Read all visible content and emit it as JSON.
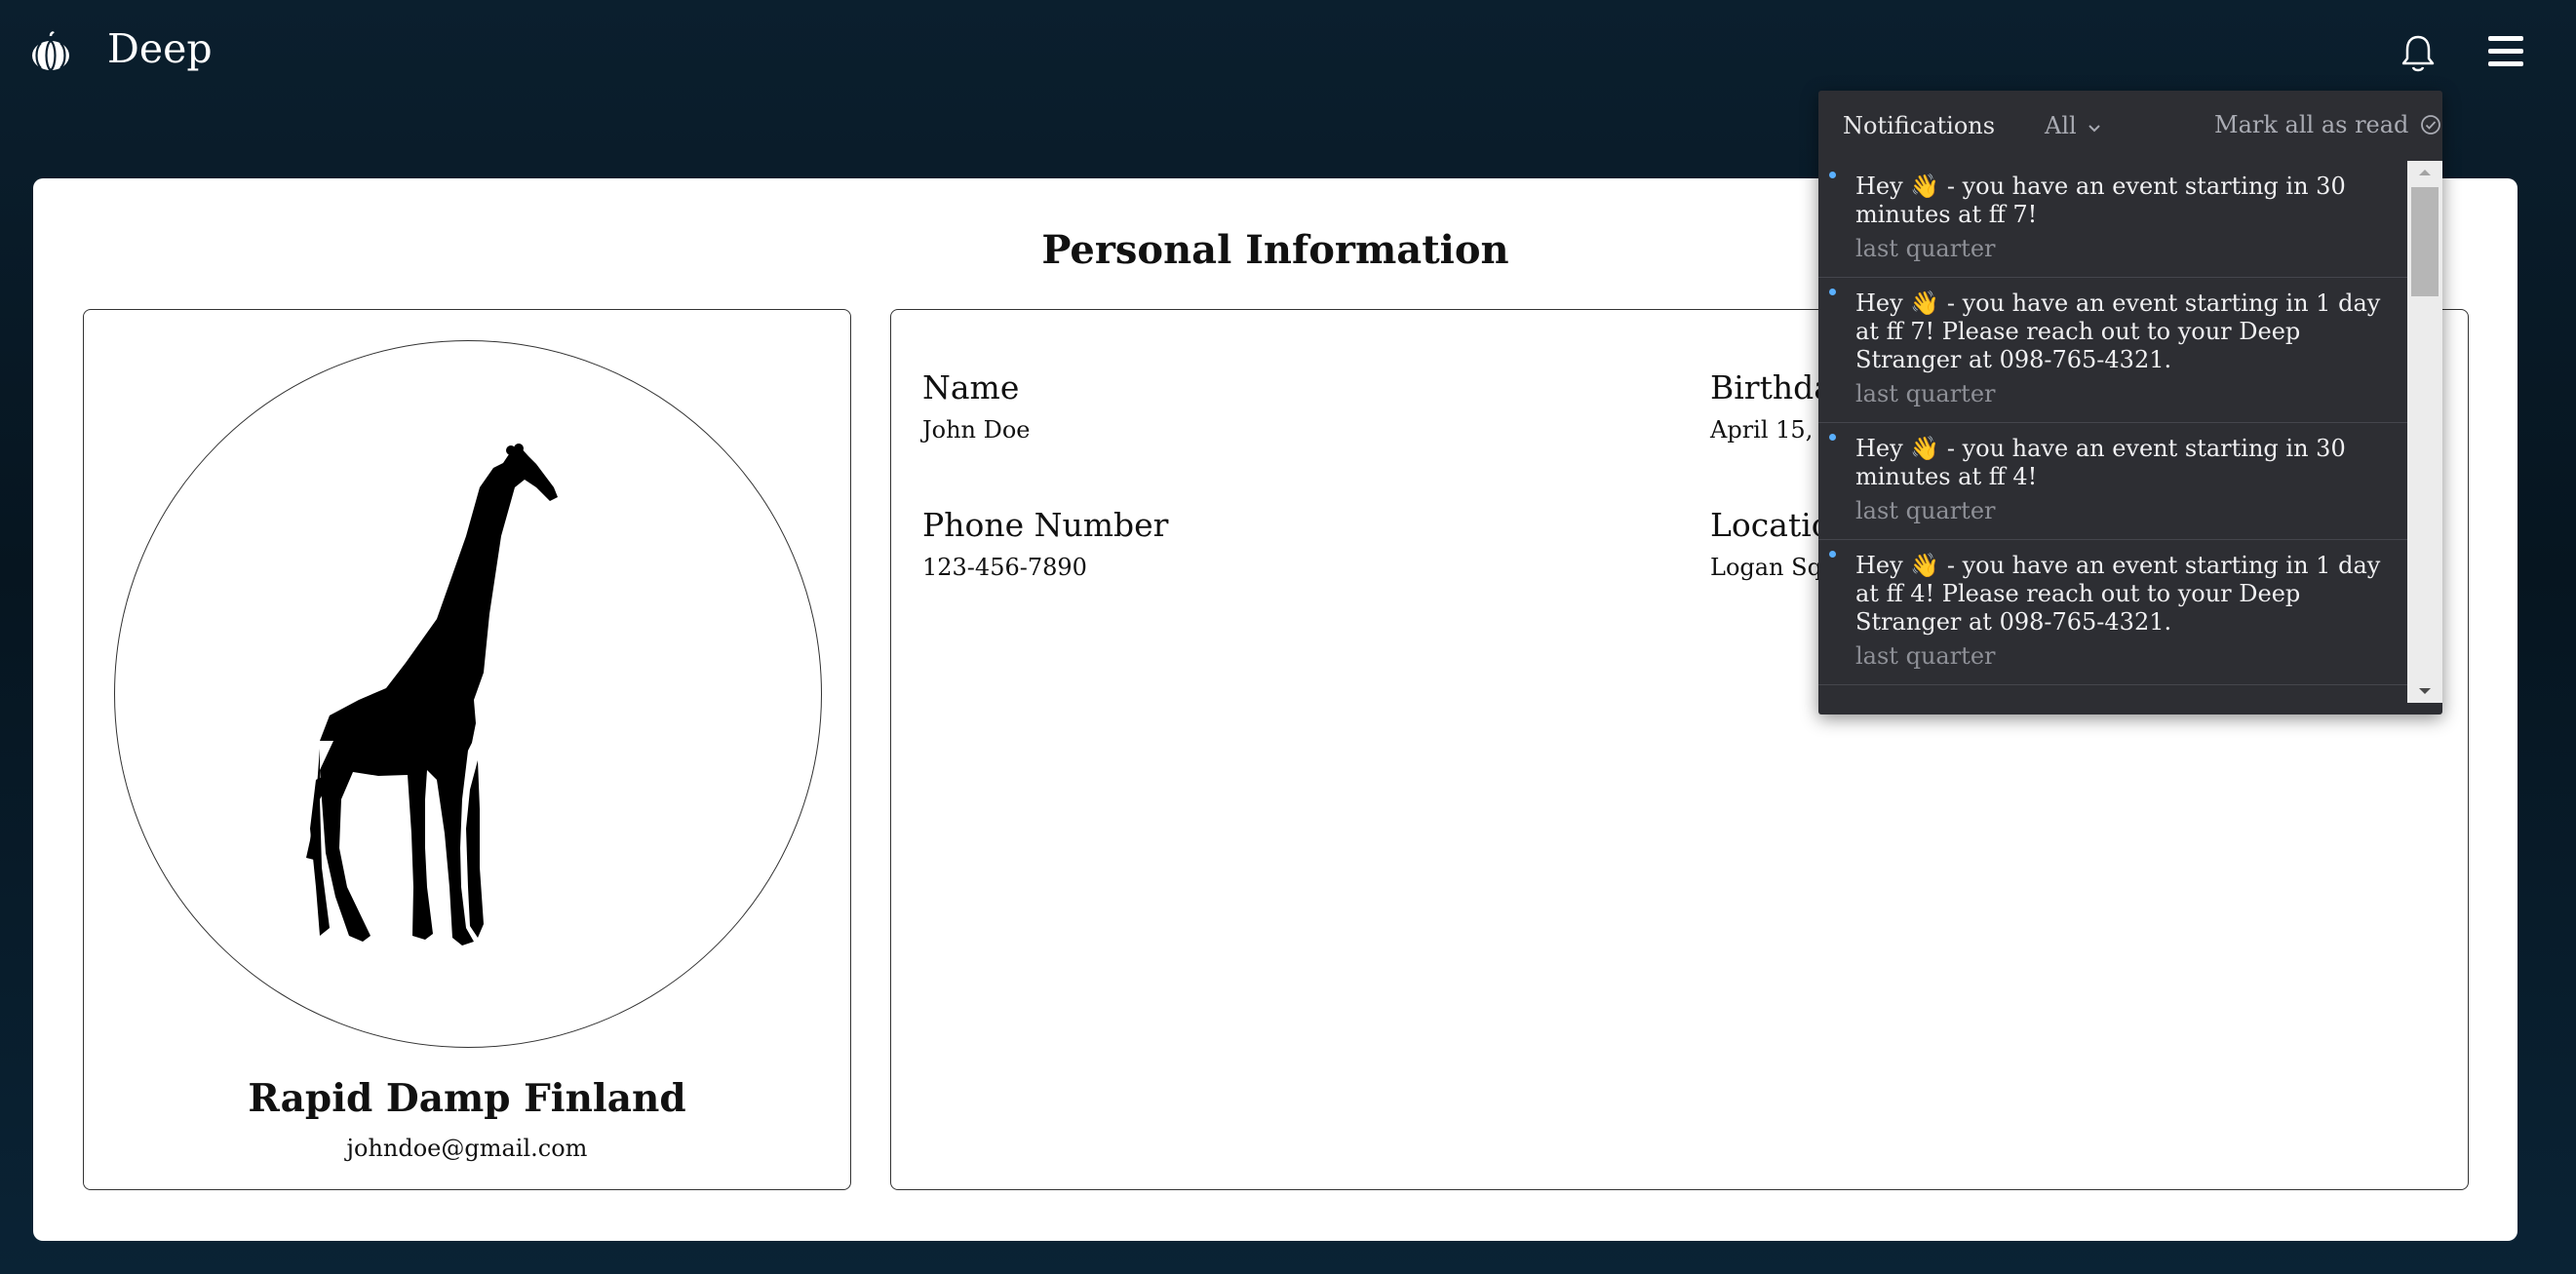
{
  "app": {
    "brand": "Deep"
  },
  "header": {
    "notifications_icon": "bell-icon",
    "menu_icon": "hamburger-menu-icon",
    "logo_icon": "pumpkin-logo-icon"
  },
  "page": {
    "title": "Personal Information"
  },
  "profile": {
    "avatar_icon": "giraffe-silhouette",
    "display_name": "Rapid Damp Finland",
    "email": "johndoe@gmail.com"
  },
  "fields": {
    "name": {
      "label": "Name",
      "value": "John Doe"
    },
    "birthday": {
      "label": "Birthday",
      "value": "April 15, 19"
    },
    "phone": {
      "label": "Phone Number",
      "value": "123-456-7890"
    },
    "location": {
      "label": "Location",
      "value": "Logan Squ"
    }
  },
  "notifications": {
    "title": "Notifications",
    "filter": "All",
    "mark_all": "Mark all as read",
    "items": [
      {
        "text": "Hey 👋 - you have an event starting in 30 minutes at ff 7!",
        "time": "last quarter",
        "unread": true
      },
      {
        "text": "Hey 👋 - you have an event starting in 1 day at ff 7! Please reach out to your Deep Stranger at 098-765-4321.",
        "time": "last quarter",
        "unread": true
      },
      {
        "text": "Hey 👋 - you have an event starting in 30 minutes at ff 4!",
        "time": "last quarter",
        "unread": true
      },
      {
        "text": "Hey 👋 - you have an event starting in 1 day at ff 4! Please reach out to your Deep Stranger at 098-765-4321.",
        "time": "last quarter",
        "unread": true
      }
    ]
  },
  "colors": {
    "unread_dot": "#5ab0ff",
    "panel_bg": "#2d2e33",
    "page_bg": "#0b1f2e"
  }
}
